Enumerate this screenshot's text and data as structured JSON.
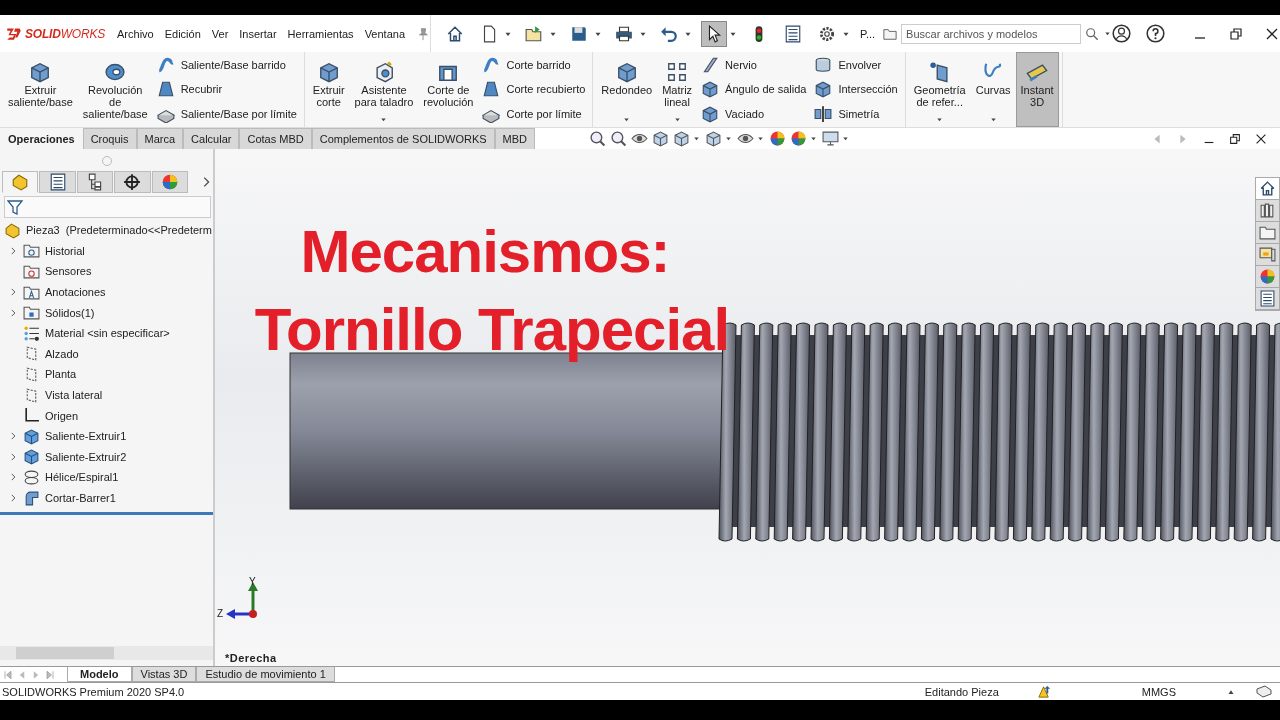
{
  "app": {
    "logo": "**SOLID**WORKS"
  },
  "menu": [
    "Archivo",
    "Edición",
    "Ver",
    "Insertar",
    "Herramientas",
    "Ventana"
  ],
  "quick_access": [
    {
      "selected": false
    },
    {
      "selected": false
    },
    {
      "selected": false
    },
    {
      "selected": false
    },
    {
      "selected": false
    },
    {
      "selected": false
    },
    {
      "selected": true
    },
    {
      "selected": false
    },
    {
      "selected": false
    },
    {
      "selected": false
    }
  ],
  "quick_overflow": "P...",
  "search": {
    "placeholder": "Buscar archivos y modelos"
  },
  "ribbon": [
    {
      "items": [
        {
          "kind": "large",
          "label": "Extruir\nsaliente/base",
          "dropdown": false,
          "selected": false
        },
        {
          "kind": "large",
          "label": "Revolución\nde\nsaliente/base",
          "dropdown": false,
          "selected": false
        },
        {
          "kind": "stack",
          "items": [
            "Saliente/Base barrido",
            "Recubrir",
            "Saliente/Base por límite"
          ]
        }
      ]
    },
    {
      "items": [
        {
          "kind": "large",
          "label": "Extruir\ncorte",
          "dropdown": false,
          "selected": false
        },
        {
          "kind": "large",
          "label": "Asistente\npara taladro",
          "dropdown": true,
          "selected": false
        },
        {
          "kind": "large",
          "label": "Corte de\nrevolución",
          "dropdown": false,
          "selected": false
        },
        {
          "kind": "stack",
          "items": [
            "Corte barrido",
            "Corte recubierto",
            "Corte por límite"
          ]
        }
      ]
    },
    {
      "items": [
        {
          "kind": "large",
          "label": "Redondeo",
          "dropdown": true,
          "selected": false
        },
        {
          "kind": "large",
          "label": "Matriz\nlineal",
          "dropdown": true,
          "selected": false
        },
        {
          "kind": "stack",
          "items": [
            "Nervio",
            "Ángulo de salida",
            "Vaciado"
          ]
        },
        {
          "kind": "stack",
          "items": [
            "Envolver",
            "Intersección",
            "Simetría"
          ]
        }
      ]
    },
    {
      "items": [
        {
          "kind": "large",
          "label": "Geometría\nde refer...",
          "dropdown": true,
          "selected": false
        },
        {
          "kind": "large",
          "label": "Curvas",
          "dropdown": true,
          "selected": false
        },
        {
          "kind": "large",
          "label": "Instant\n3D",
          "dropdown": false,
          "selected": true
        }
      ]
    }
  ],
  "command_tabs": [
    {
      "label": "Operaciones",
      "selected": true
    },
    {
      "label": "Croquis",
      "selected": false
    },
    {
      "label": "Marca",
      "selected": false
    },
    {
      "label": "Calcular",
      "selected": false
    },
    {
      "label": "Cotas MBD",
      "selected": false
    },
    {
      "label": "Complementos de SOLIDWORKS",
      "selected": false
    },
    {
      "label": "MBD",
      "selected": false
    }
  ],
  "feature_manager": {
    "tabs": [
      {
        "selected": true
      },
      {
        "selected": false
      },
      {
        "selected": false
      },
      {
        "selected": false
      },
      {
        "selected": false
      }
    ],
    "root": "Pieza3  (Predeterminado<<Predeterm",
    "items": [
      {
        "label": "Historial",
        "expandable": true
      },
      {
        "label": "Sensores",
        "expandable": false
      },
      {
        "label": "Anotaciones",
        "expandable": true
      },
      {
        "label": "Sólidos(1)",
        "expandable": true
      },
      {
        "label": "Material <sin especificar>",
        "expandable": false
      },
      {
        "label": "Alzado",
        "expandable": false
      },
      {
        "label": "Planta",
        "expandable": false
      },
      {
        "label": "Vista lateral",
        "expandable": false
      },
      {
        "label": "Origen",
        "expandable": false
      },
      {
        "label": "Saliente-Extruir1",
        "expandable": true
      },
      {
        "label": "Saliente-Extruir2",
        "expandable": true
      },
      {
        "label": "Hélice/Espiral1",
        "expandable": true
      },
      {
        "label": "Cortar-Barrer1",
        "expandable": true
      }
    ]
  },
  "viewport": {
    "title_lines": [
      "Mecanismos:",
      "Tornillo Trapecial"
    ],
    "axis_labels": [
      "Y",
      "Z"
    ],
    "view_name": "*Derecha"
  },
  "task_pane": [
    {
      "selected": true
    },
    {
      "selected": false
    },
    {
      "selected": false
    },
    {
      "selected": false
    },
    {
      "selected": false
    },
    {
      "selected": false
    }
  ],
  "bottom_tabs": [
    {
      "label": "Modelo",
      "selected": true
    },
    {
      "label": "Vistas 3D",
      "selected": false
    },
    {
      "label": "Estudio de movimiento 1",
      "selected": false
    }
  ],
  "status_bar": {
    "product": "SOLIDWORKS Premium 2020 SP4.0",
    "mode": "Editando Pieza",
    "units": "MMGS"
  }
}
